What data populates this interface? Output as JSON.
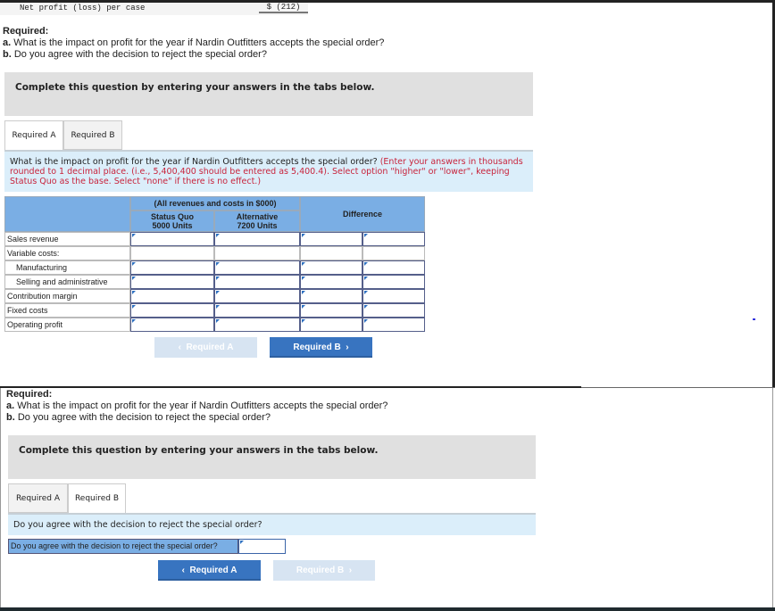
{
  "top_row": {
    "label": "Net profit (loss) per case",
    "value": "$ (212)"
  },
  "required": {
    "heading": "Required:",
    "a_prefix": "a.",
    "a_text": " What is the impact on profit for the year if Nardin Outfitters accepts the special order?",
    "b_prefix": "b.",
    "b_text": " Do you agree with the decision to reject the special order?"
  },
  "panel_text": "Complete this question by entering your answers in the tabs below.",
  "tabs": [
    "Required A",
    "Required B"
  ],
  "part_a": {
    "question": "What is the impact on profit for the year if Nardin Outfitters accepts the special order?",
    "instruction": "(Enter your answers in thousands rounded to 1 decimal place. (i.e., 5,400,400 should be entered as 5,400.4). Select option \"higher\" or \"lower\", keeping Status Quo as the base. Select \"none\" if there is no effect.)",
    "table": {
      "group_header": "(All revenues and costs in $000)",
      "col_status_quo": [
        "Status Quo",
        "5000 Units"
      ],
      "col_alternative": [
        "Alternative",
        "7200 Units"
      ],
      "col_difference": "Difference",
      "rows": [
        {
          "label": "Sales revenue",
          "inputs": true,
          "indent": false
        },
        {
          "label": "Variable costs:",
          "inputs": false,
          "indent": false
        },
        {
          "label": "Manufacturing",
          "inputs": true,
          "indent": true
        },
        {
          "label": "Selling and administrative",
          "inputs": true,
          "indent": true
        },
        {
          "label": "Contribution margin",
          "inputs": true,
          "indent": false
        },
        {
          "label": "Fixed costs",
          "inputs": true,
          "indent": false
        },
        {
          "label": "Operating profit",
          "inputs": true,
          "indent": false
        }
      ]
    },
    "prev_button": "Required A",
    "next_button": "Required B"
  },
  "part_b": {
    "question": "Do you agree with the decision to reject the special order?",
    "row_label": "Do you agree with the decision to reject the special order?",
    "answer": "",
    "prev_button": "Required A",
    "next_button": "Required B"
  },
  "colors": {
    "accent": "#3874c0",
    "header_blue": "#7aaee4",
    "instruction_bg": "#dbeefa",
    "instruction_red": "#c8243c"
  }
}
